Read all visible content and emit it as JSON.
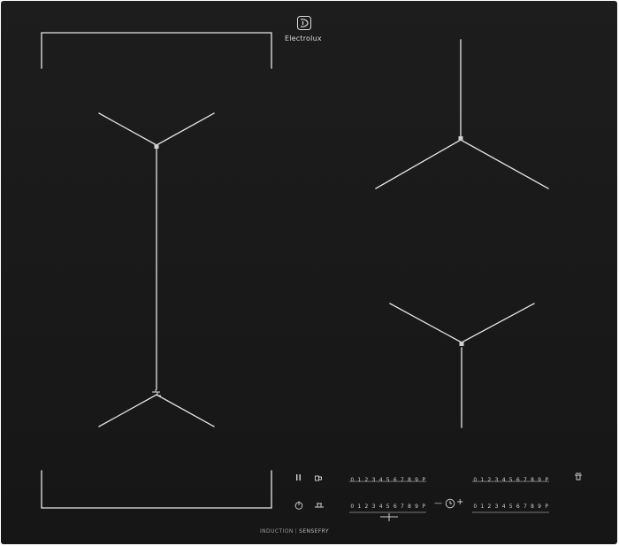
{
  "brand": {
    "name": "Electrolux",
    "logo": "electrolux-logo"
  },
  "footer": {
    "left": "INDUCTION",
    "separator": "|",
    "right": "SENSEFRY"
  },
  "power_scale": [
    "0",
    "1",
    "2",
    "3",
    "4",
    "5",
    "6",
    "7",
    "8",
    "9",
    "P"
  ],
  "controls": {
    "pause_icon": "pause-icon",
    "lock_icon": "child-lock-icon",
    "power_icon": "power-icon",
    "bridge_icon": "bridge-icon",
    "timer_minus": "—",
    "timer_plus": "+",
    "timer_icon": "timer-icon",
    "hood_icon": "hob2hood-icon"
  },
  "colors": {
    "surface": "#1a1a1a",
    "lines": "#e6e6e6",
    "text": "#d9d9d9"
  }
}
